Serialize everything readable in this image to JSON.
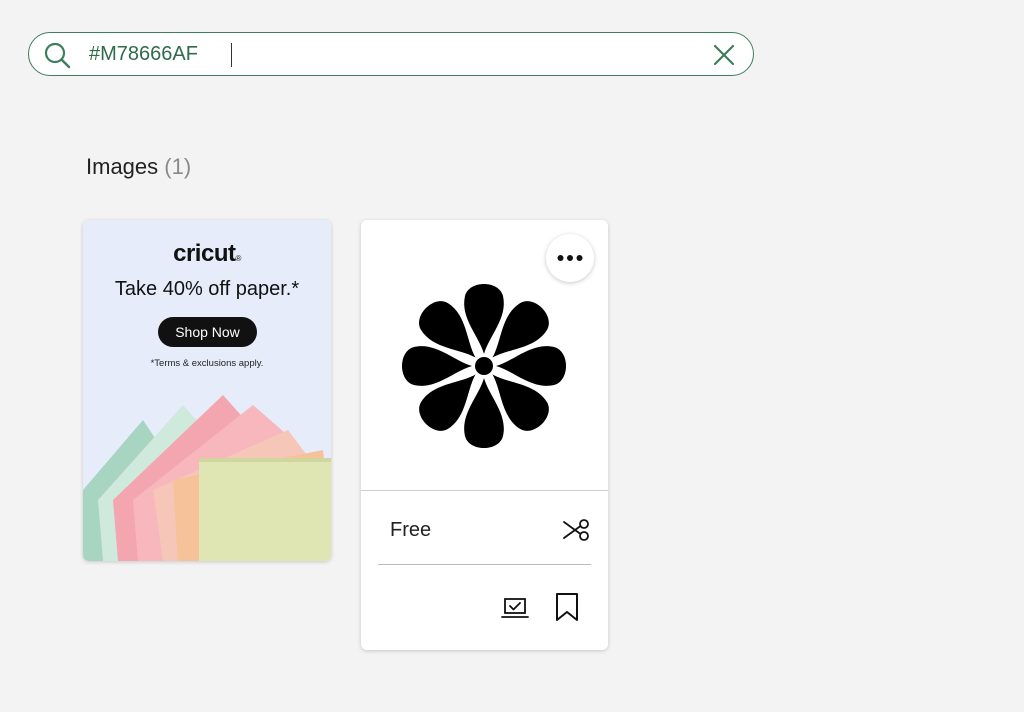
{
  "search": {
    "value": "#M78666AF",
    "accent_color": "#3e7d5e"
  },
  "results": {
    "heading": "Images",
    "count": "(1)"
  },
  "ad": {
    "brand": "cricut",
    "brand_mark": "®",
    "headline": "Take 40% off paper.*",
    "cta": "Shop Now",
    "terms": "*Terms & exclusions apply."
  },
  "image_card": {
    "price": "Free",
    "preview_icon": "flower-icon",
    "more_icon": "more-horizontal-icon",
    "cut_icon": "scissors-icon",
    "design_icon": "laptop-check-icon",
    "bookmark_icon": "bookmark-icon"
  }
}
